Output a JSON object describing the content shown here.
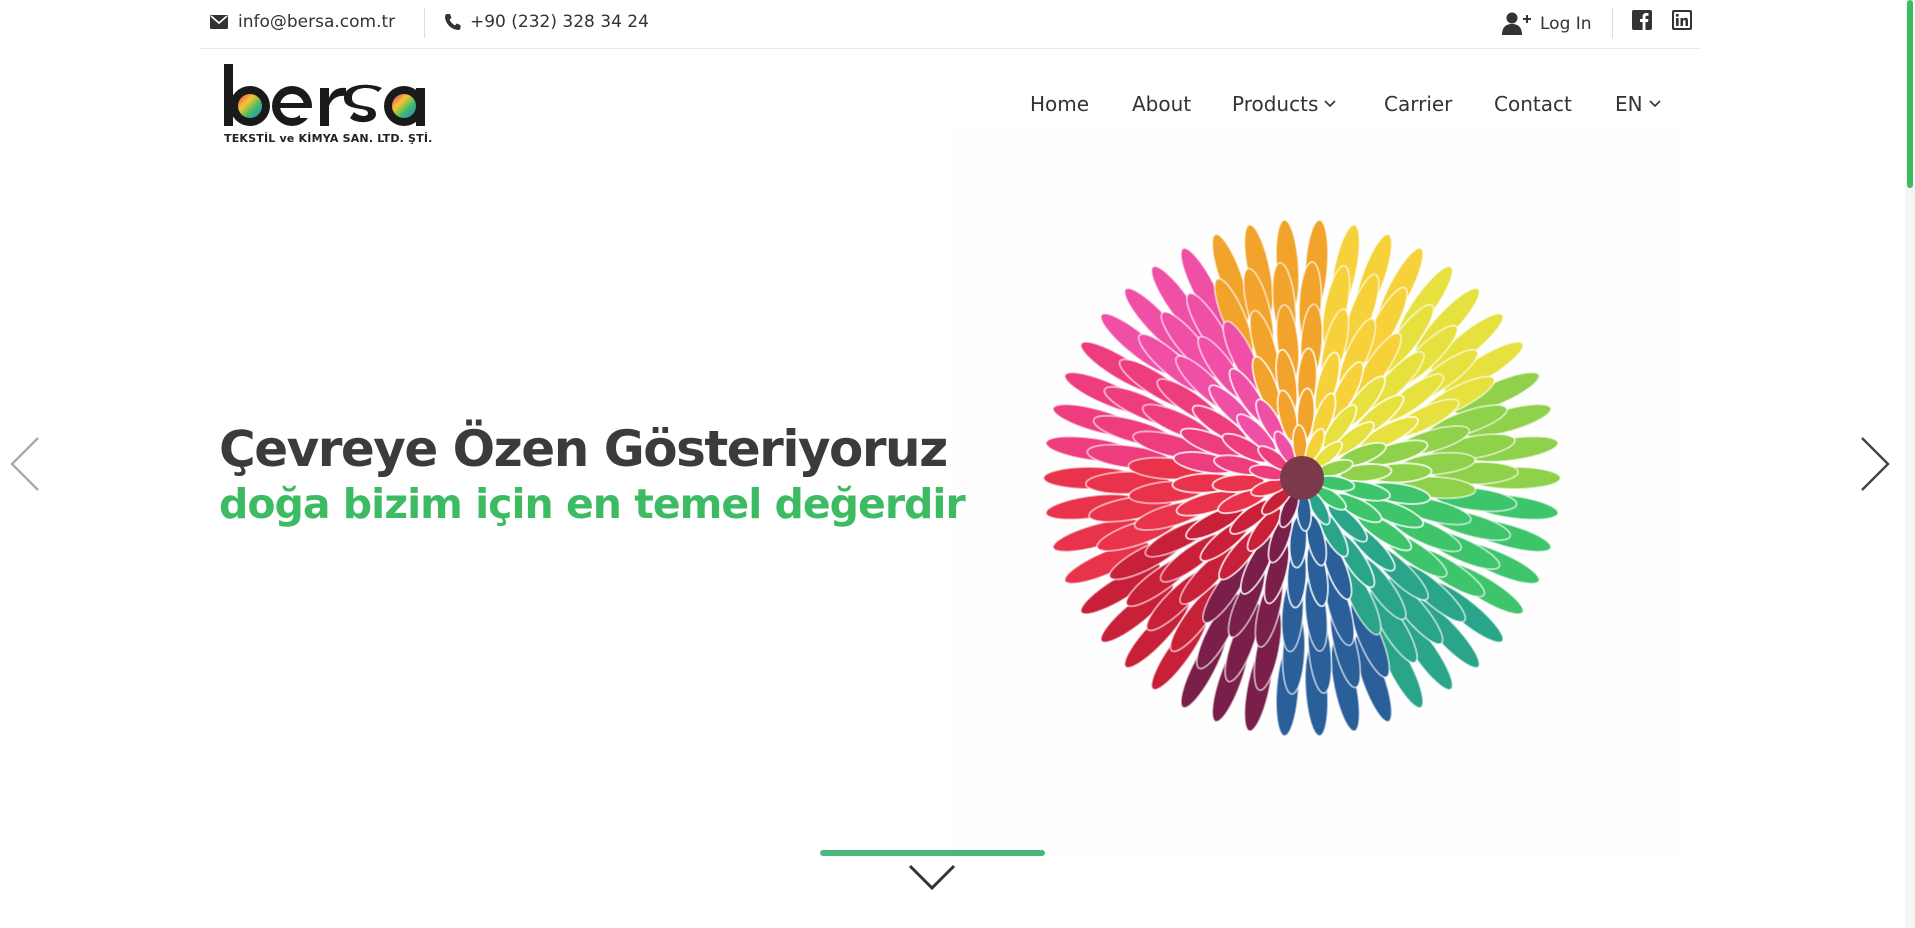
{
  "topbar": {
    "email": "info@bersa.com.tr",
    "phone": "+90 (232) 328 34 24",
    "login": "Log In",
    "social": [
      "facebook-icon",
      "linkedin-icon"
    ]
  },
  "logo": {
    "word": "bersa",
    "subtitle": "TEKSTİL ve KİMYA SAN. LTD. ŞTİ."
  },
  "nav": {
    "items": [
      "Home",
      "About",
      "Products",
      "Carrier",
      "Contact",
      "EN"
    ]
  },
  "hero": {
    "title": "Çevreye Özen Gösteriyoruz",
    "subtitle": "doğa bizim için en temel değerdir"
  },
  "colors": {
    "accent": "#3dbb62",
    "text": "#3b3b3b"
  }
}
